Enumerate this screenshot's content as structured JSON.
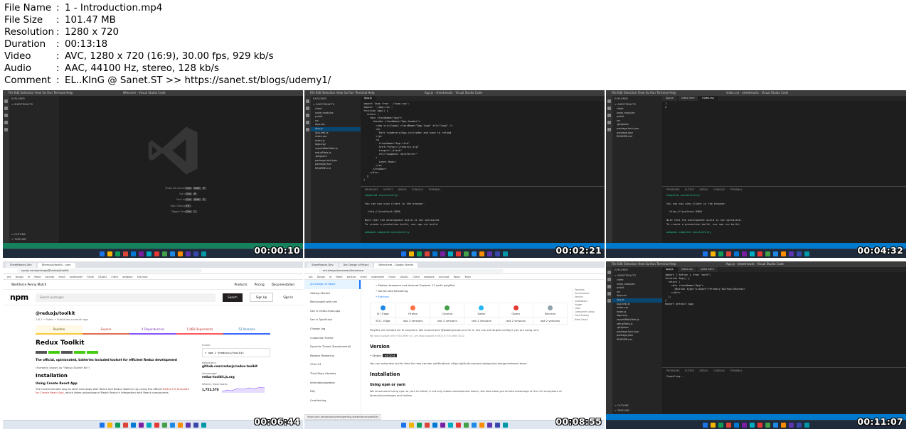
{
  "info": [
    {
      "key": "File Name",
      "value": "1 - Introduction.mp4"
    },
    {
      "key": "File Size",
      "value": "101.47 MB"
    },
    {
      "key": "Resolution",
      "value": "1280 x 720"
    },
    {
      "key": "Duration",
      "value": "00:13:18"
    },
    {
      "key": "Video",
      "value": "AVC, 1280 x 720 (16:9), 30.00 fps, 929 kb/s"
    },
    {
      "key": "Audio",
      "value": "AAC, 44100 Hz, stereo, 128 kb/s"
    },
    {
      "key": "Comment",
      "value": "EL..KInG @ Sanet.ST >> https://sanet.st/blogs/udemy1/"
    }
  ],
  "separator": ":",
  "thumbs": {
    "t1": {
      "timestamp": "00:00:10",
      "title": "Welcome - Visual Studio Code",
      "menu": "File  Edit  Selection  View  Go  Run  Terminal  Help",
      "explorer": "EXPLORER",
      "folder": "> SHEETREACTS",
      "outline": "> OUTLINE",
      "timeline": "> TIMELINE",
      "shortcuts": [
        "Show All Commands",
        "Go to File",
        "Find in Files",
        "Start Debugging",
        "Toggle Terminal"
      ],
      "keys": [
        [
          "Ctrl",
          "Shift",
          "P"
        ],
        [
          "Ctrl",
          "P"
        ],
        [
          "Ctrl",
          "Shift",
          "F"
        ],
        [
          "F5"
        ],
        [
          "Ctrl",
          "`"
        ]
      ]
    },
    "t2": {
      "timestamp": "00:02:21",
      "title": "App.js - sheetreacts - Visual Studio Code",
      "tab": "App.js",
      "files": [
        "client",
        "node_modules",
        "public",
        "src",
        "App.css",
        "App.js",
        "App.test.js",
        "index.css",
        "index.js",
        "logo.svg",
        "reportWebVitals.js",
        "setupTests.js",
        ".gitignore",
        "package-lock.json",
        "package.json",
        "README.md"
      ],
      "selected_file": "App.js",
      "code": [
        "import logo from './logo.svg';",
        "import './App.css';",
        "",
        "function App() {",
        "  return (",
        "    <div className=\"App\">",
        "      <header className=\"App-header\">",
        "        <img src={logo} className=\"App-logo\" alt=\"logo\" />",
        "        <p>",
        "          Edit <code>src/App.js</code> and save to reload.",
        "        </p>",
        "        <a",
        "          className=\"App-link\"",
        "          href=\"https://reactjs.org\"",
        "          target=\"_blank\"",
        "          rel=\"noopener noreferrer\"",
        "        >",
        "          Learn React",
        "        </a>",
        "      </header>",
        "    </div>",
        "  );",
        "}"
      ],
      "panel_tabs": "PROBLEMS  OUTPUT  DEBUG CONSOLE  TERMINAL",
      "terminal": [
        "Compiled successfully!",
        "",
        "You can now view client in the browser.",
        "",
        "  http://localhost:3000",
        "",
        "Note that the development build is not optimized.",
        "To create a production build, use npm run build.",
        "",
        "webpack compiled successfully"
      ]
    },
    "t3": {
      "timestamp": "00:04:32",
      "title": "index.css - sheetreacts - Visual Studio Code",
      "tabs": [
        "App.js",
        "index.html",
        "index.css"
      ],
      "files": [
        "client",
        "node_modules",
        "public",
        "src",
        ".gitignore",
        "package-lock.json",
        "package.json",
        "README.md"
      ],
      "code": [
        "1",
        "2"
      ],
      "panel_tabs": "PROBLEMS  OUTPUT  DEBUG CONSOLE  TERMINAL",
      "terminal": [
        "Compiled successfully!",
        "",
        "You can now view client in the browser.",
        "",
        "  http://localhost:3000",
        "",
        "Note that the development build is not optimized.",
        "To create a production build, use npm run build.",
        "",
        "webpack compiled successfully"
      ]
    },
    "t4": {
      "timestamp": "00:06:44",
      "tabs": [
        "SheetReacts Dev",
        "@reduxjs/toolkit - npm"
      ],
      "url": "npmjs.com/package/@reduxjs/toolkit",
      "bookmarks": "Ant Design of React  sanitize email  nodemailer  Gmail  OAuth2 Client  webpack  ant-react",
      "tagline": "Workforce Penny Match",
      "links": [
        "Products",
        "Pricing",
        "Documentation"
      ],
      "logo": "npm",
      "search_placeholder": "Search packages",
      "search_btn": "Search",
      "signup": "Sign Up",
      "signin": "Sign In",
      "pkg": "@reduxjs/toolkit",
      "meta": "1.8.1 • Public • Published a month ago",
      "tabs_pkg": [
        "Readme",
        "Explore",
        "4 Dependencies",
        "1,868 Dependents",
        "52 Versions"
      ],
      "h1": "Redux Toolkit",
      "desc": "The official, opinionated, batteries-included toolset for efficient Redux development",
      "formerly": "(Formerly known as \"Redux Starter Kit\")",
      "h2": "Installation",
      "h3": "Using Create React App",
      "p2a": "The recommended way to start new apps with React and Redux Toolkit is by using the official",
      "p2b": "Redux+JS template for Create React App",
      "p2c": ", which takes advantage of React Redux's integration with React components.",
      "install_label": "Install",
      "install_cmd": "> npm i @reduxjs/toolkit",
      "repo_label": "Repository",
      "repo": "github.com/reduxjs/redux-toolkit",
      "home_label": "Homepage",
      "home": "redux-toolkit.js.org",
      "weekly_label": "Weekly Downloads",
      "weekly": "1,752,570"
    },
    "t5": {
      "timestamp": "00:08:55",
      "tabs": [
        "SheetReacts Dev",
        "Ant Design of React",
        "Worksheet - Google Sheets"
      ],
      "url": "ant.design/docs/react/introduce",
      "bookmarks": "Ant Design of React  sanitize email  nodemailer  Gmail  OAuth2 Client  webpack  ant-react  React Team",
      "nav": [
        "Ant Design of React",
        "Getting Started",
        "Real project with umi",
        "Use in create-react-app",
        "Use in TypeScript",
        "Change Log",
        "Customize Theme",
        "Dynamic Theme (Experimental)",
        "Replace Moment.js",
        "V3 to V4",
        "Third-Party Libraries",
        "Internationalization",
        "FAQ",
        "Contributing"
      ],
      "list": [
        "Modern browsers and Internet Explorer 11 (with polyfills)",
        "Server-side Rendering",
        "Electron"
      ],
      "browsers": [
        "IE / Edge",
        "Firefox",
        "Chrome",
        "Safari",
        "Opera",
        "Electron"
      ],
      "browser_colors": [
        "#1e88e5",
        "#ff7043",
        "#43a047",
        "#29b6f6",
        "#e53935",
        "#90a4ae"
      ],
      "support": [
        "IE11, Edge",
        "last 2 versions",
        "last 2 versions",
        "last 2 versions",
        "last 2 versions",
        "last 2 versions"
      ],
      "note": "Polyfills are needed for IE browsers. We recommend @babel/preset-env for it. You can set targets config if you are using umi.",
      "small": "We stop support of IE 9/10 after 4.0, we drop support of IE11 in 5.0 after 2022.",
      "h_version": "Version",
      "stable_label": "Stable:",
      "stable": "v4.20.4",
      "subscribe": "You can subscribe to this feed for new version notifications: https://github.com/ant-design/ant-design/releases.atom",
      "h_install": "Installation",
      "h_npm": "Using npm or yarn",
      "p": "We recommend using npm or yarn to install, it not only makes development easier, but also allow you to take advantage of the rich ecosystem of Javascript packages and tooling.",
      "toc": [
        "Features",
        "Environment",
        "Version",
        "Installation",
        "Usage",
        "Links",
        "Companies using",
        "Contributing",
        "Need Help?"
      ],
      "status_url": "https://ant.design/docs/react/getting-started#compatibility"
    },
    "t6": {
      "timestamp": "00:11:07",
      "title": "App.js - sheetreacts - Visual Studio Code",
      "tabs": [
        "App.js",
        "index.css",
        "index.html"
      ],
      "files": [
        "client",
        "node_modules",
        "public",
        "src",
        "App.css",
        "App.js",
        "App.test.js",
        "index.css",
        "index.js",
        "logo.svg",
        "reportWebVitals.js",
        "setupTests.js",
        ".gitignore",
        "package-lock.json",
        "package.json",
        "README.md"
      ],
      "selected_file": "App.js",
      "code": [
        "import { Button } from \"antd\";",
        "function App() {",
        "  return (",
        "    <div className=\"App\">",
        "      <Button type=\"primary\">Primary Button</Button>",
        "    </div>",
        "  );",
        "}",
        "",
        "export default App;"
      ],
      "panel_tabs": "PROBLEMS  OUTPUT  DEBUG CONSOLE  TERMINAL",
      "terminal": [
        "Compiling..."
      ]
    }
  }
}
